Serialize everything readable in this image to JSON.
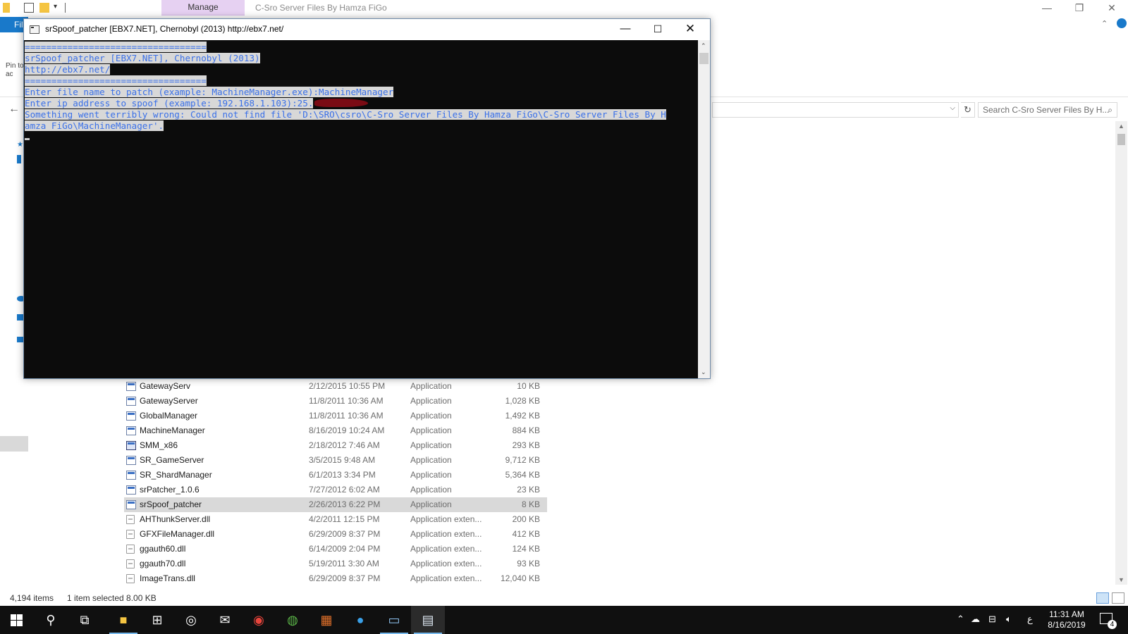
{
  "explorer": {
    "contextual_tab": "Manage",
    "window_title": "C-Sro Server Files By Hamza FiGo",
    "file_tab": "File",
    "ribbon_pin_text": "Pin to\nac",
    "search_placeholder": "Search C-Sro Server Files By H...",
    "files": [
      {
        "name": "GatewayServ",
        "date": "2/12/2015 10:55 PM",
        "type": "Application",
        "size": "10 KB",
        "icon": "application-icon"
      },
      {
        "name": "GatewayServer",
        "date": "11/8/2011 10:36 AM",
        "type": "Application",
        "size": "1,028 KB",
        "icon": "application-icon"
      },
      {
        "name": "GlobalManager",
        "date": "11/8/2011 10:36 AM",
        "type": "Application",
        "size": "1,492 KB",
        "icon": "application-icon"
      },
      {
        "name": "MachineManager",
        "date": "8/16/2019 10:24 AM",
        "type": "Application",
        "size": "884 KB",
        "icon": "application-icon"
      },
      {
        "name": "SMM_x86",
        "date": "2/18/2012 7:46 AM",
        "type": "Application",
        "size": "293 KB",
        "icon": "smm-application-icon"
      },
      {
        "name": "SR_GameServer",
        "date": "3/5/2015 9:48 AM",
        "type": "Application",
        "size": "9,712 KB",
        "icon": "application-icon"
      },
      {
        "name": "SR_ShardManager",
        "date": "6/1/2013 3:34 PM",
        "type": "Application",
        "size": "5,364 KB",
        "icon": "application-icon"
      },
      {
        "name": "srPatcher_1.0.6",
        "date": "7/27/2012 6:02 AM",
        "type": "Application",
        "size": "23 KB",
        "icon": "application-icon"
      },
      {
        "name": "srSpoof_patcher",
        "date": "2/26/2013 6:22 PM",
        "type": "Application",
        "size": "8 KB",
        "icon": "application-icon",
        "selected": true
      },
      {
        "name": "AHThunkServer.dll",
        "date": "4/2/2011 12:15 PM",
        "type": "Application exten...",
        "size": "200 KB",
        "icon": "dll-file-icon"
      },
      {
        "name": "GFXFileManager.dll",
        "date": "6/29/2009 8:37 PM",
        "type": "Application exten...",
        "size": "412 KB",
        "icon": "dll-file-icon"
      },
      {
        "name": "ggauth60.dll",
        "date": "6/14/2009 2:04 PM",
        "type": "Application exten...",
        "size": "124 KB",
        "icon": "dll-file-icon"
      },
      {
        "name": "ggauth70.dll",
        "date": "5/19/2011 3:30 AM",
        "type": "Application exten...",
        "size": "93 KB",
        "icon": "dll-file-icon"
      },
      {
        "name": "ImageTrans.dll",
        "date": "6/29/2009 8:37 PM",
        "type": "Application exten...",
        "size": "12,040 KB",
        "icon": "dll-file-icon"
      }
    ],
    "status": {
      "item_count": "4,194 items",
      "selection": "1 item selected  8.00 KB"
    }
  },
  "console": {
    "title": "srSpoof_patcher [EBX7.NET], Chernobyl (2013) http://ebx7.net/",
    "lines": {
      "l1": "==================================",
      "l2": "srSpoof_patcher [EBX7.NET], Chernobyl (2013)",
      "l3": "http://ebx7.net/",
      "l4": "==================================",
      "l5": "Enter file name to patch (example: MachineManager.exe):MachineManager",
      "l6": "Enter ip address to spoof (example: 192.168.1.103):25.",
      "l7": "Something went terribly wrong: Could not find file 'D:\\SRO\\csro\\C-Sro Server Files By Hamza FiGo\\C-Sro Server Files By H",
      "l8": "amza FiGo\\MachineManager'."
    }
  },
  "taskbar": {
    "clock_time": "11:31 AM",
    "clock_date": "8/16/2019",
    "input_language": "ع",
    "notification_count": "4",
    "apps": [
      "start-icon",
      "search-icon",
      "task-view-icon",
      "file-explorer-icon",
      "store-icon",
      "media-app-icon",
      "mail-icon",
      "chrome-icon",
      "globe-app-icon",
      "photo-app-icon",
      "blue-circle-app-icon",
      "window-app-icon",
      "console-app-icon"
    ]
  },
  "colors": {
    "console_text": "#3b78ff",
    "console_bg": "#0c0c0c",
    "manage_tab": "#e6d1f2",
    "file_tab": "#1979ca",
    "taskbar": "#101010"
  }
}
